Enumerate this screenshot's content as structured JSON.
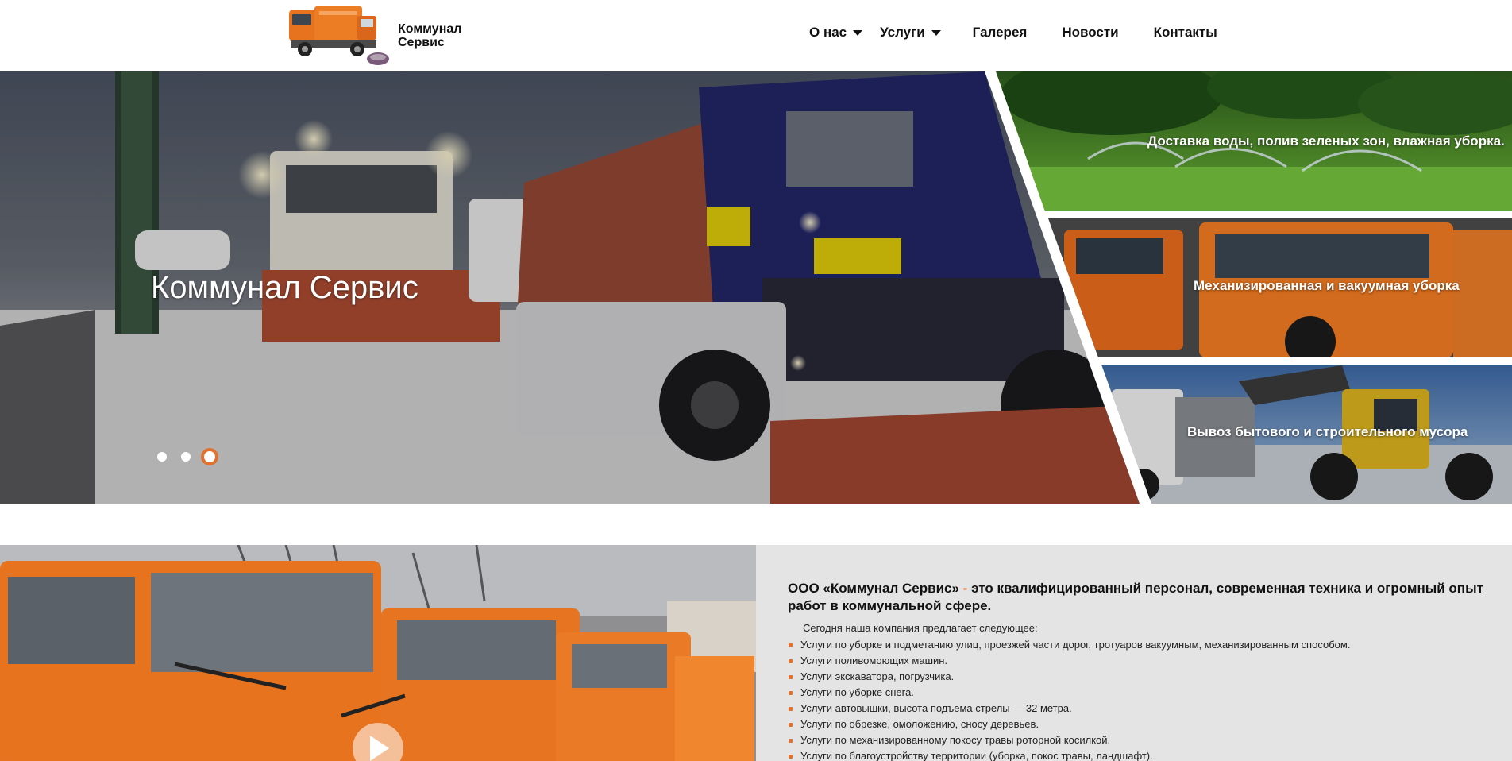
{
  "header": {
    "brand_line1": "Коммунал",
    "brand_line2": "Сервис",
    "nav": [
      {
        "label": "О нас",
        "has_dropdown": true
      },
      {
        "label": "Услуги",
        "has_dropdown": true
      },
      {
        "label": "Галерея",
        "has_dropdown": false
      },
      {
        "label": "Новости",
        "has_dropdown": false
      },
      {
        "label": "Контакты",
        "has_dropdown": false
      }
    ]
  },
  "hero": {
    "slide_title": "Коммунал Сервис",
    "slides_count": 3,
    "active_slide": 3,
    "panels": [
      {
        "label": "Доставка воды, полив зеленых зон, влажная уборка."
      },
      {
        "label": "Механизированная и вакуумная уборка"
      },
      {
        "label": "Вывоз бытового и строительного мусора"
      }
    ]
  },
  "about": {
    "heading_company": "ООО «Коммунал Сервис»",
    "heading_sep": "-",
    "heading_rest": "это квалифицированный персонал, современная техника и огромный опыт работ в коммунальной сфере.",
    "intro": "Сегодня наша компания предлагает следующее:",
    "services": [
      "Услуги по уборке и подметанию улиц, проезжей части дорог, тротуаров вакуумным, механизированным способом.",
      "Услуги поливомоющих машин.",
      "Услуги экскаватора, погрузчика.",
      "Услуги по уборке снега.",
      "Услуги автовышки, высота подъема стрелы — 32 метра.",
      "Услуги по обрезке, омоложению, сносу деревьев.",
      "Услуги по механизированному покосу травы роторной косилкой.",
      "Услуги по благоустройству территории (уборка, покос травы, ландшафт)."
    ]
  },
  "colors": {
    "accent": "#e2712f",
    "truck_orange": "#e8731f",
    "about_bg": "#e4e4e4"
  },
  "icons": [
    "caret-down-icon",
    "play-icon",
    "logo-truck-icon"
  ]
}
